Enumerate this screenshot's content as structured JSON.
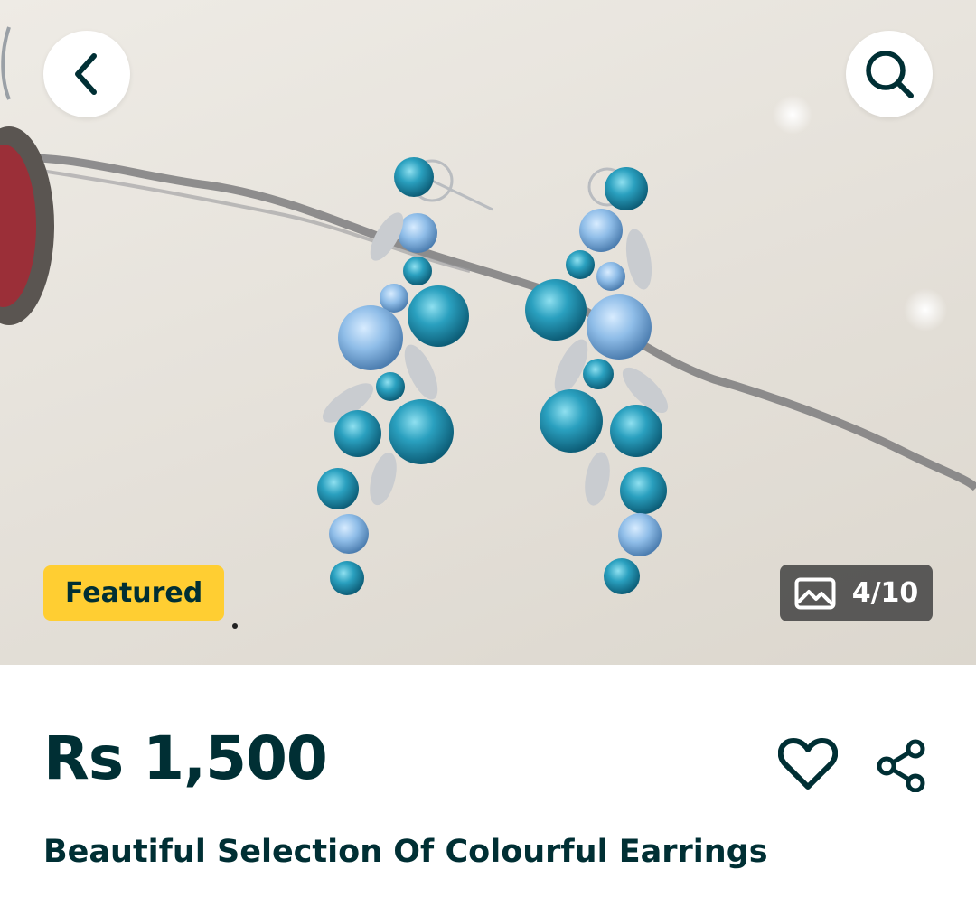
{
  "header": {
    "back_icon": "chevron-left-icon",
    "search_icon": "search-icon"
  },
  "gallery": {
    "badge_label": "Featured",
    "badge_color": "#ffce32",
    "image_icon": "image-icon",
    "counter": "4/10"
  },
  "listing": {
    "price": "Rs 1,500",
    "title": "Beautiful Selection Of Colourful Earrings",
    "favorite_icon": "heart-icon",
    "share_icon": "share-icon"
  },
  "colors": {
    "text": "#002f34",
    "badge": "#ffce32"
  }
}
